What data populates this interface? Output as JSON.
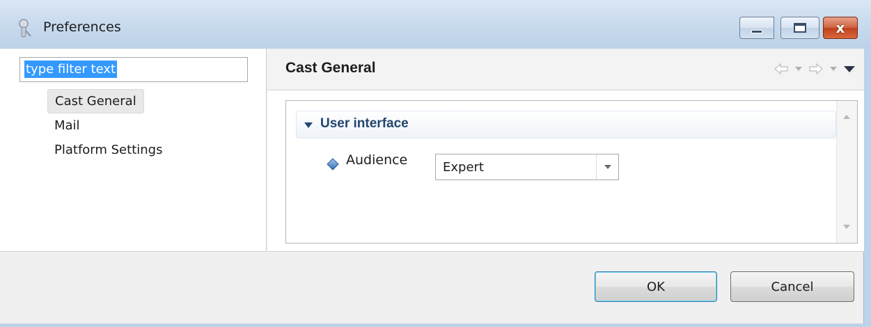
{
  "window": {
    "title": "Preferences",
    "app_icon": "eclipse-preferences-icon",
    "controls": {
      "minimize_icon": "minimize-icon",
      "maximize_icon": "maximize-icon",
      "close_glyph": "x"
    }
  },
  "sidebar": {
    "filter_value": "type filter text",
    "items": [
      {
        "label": "Cast General",
        "selected": true
      },
      {
        "label": "Mail",
        "selected": false
      },
      {
        "label": "Platform Settings",
        "selected": false
      }
    ]
  },
  "page": {
    "title": "Cast General",
    "nav_icons": [
      "back-arrow-icon",
      "back-dropdown-icon",
      "forward-arrow-icon",
      "forward-dropdown-icon",
      "view-menu-icon"
    ],
    "section": {
      "title": "User interface",
      "expanded": true,
      "properties": [
        {
          "label": "Audience",
          "value": "Expert",
          "icon": "diamond-icon"
        }
      ]
    }
  },
  "footer": {
    "ok_label": "OK",
    "cancel_label": "Cancel"
  },
  "colors": {
    "titlebar": "#c9dbee",
    "selection": "#3399ff",
    "section_title": "#22466f",
    "close_button": "#c1401b"
  }
}
